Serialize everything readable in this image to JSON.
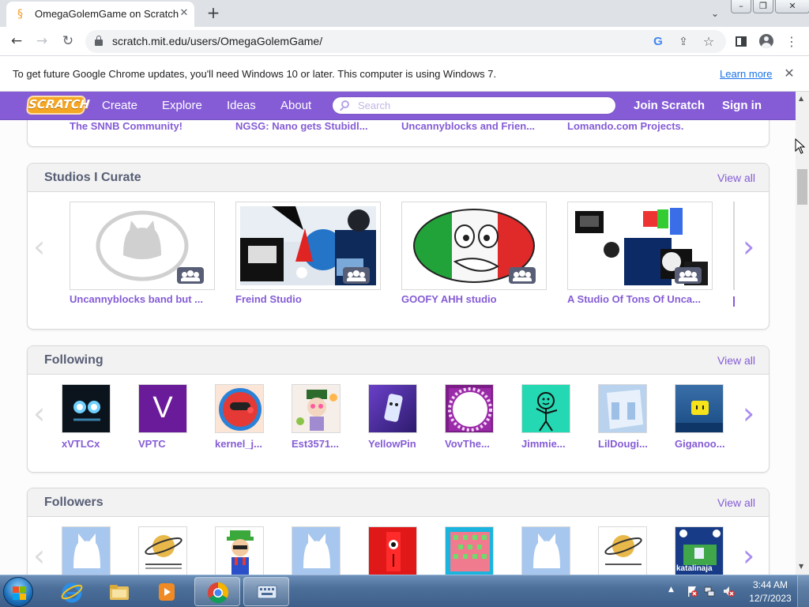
{
  "browser": {
    "tab_title": "OmegaGolemGame on Scratch",
    "url": "scratch.mit.edu/users/OmegaGolemGame/",
    "infobar_text": "To get future Google Chrome updates, you'll need Windows 10 or later. This computer is using Windows 7.",
    "infobar_link": "Learn more"
  },
  "scratch_nav": {
    "logo": "SCRATCH",
    "create": "Create",
    "explore": "Explore",
    "ideas": "Ideas",
    "about": "About",
    "search_placeholder": "Search",
    "join": "Join Scratch",
    "signin": "Sign in",
    "brand_color": "#855cd6"
  },
  "top_strip": {
    "items": [
      "The SNNB Community!",
      "NGSG: Nano gets Stubidl...",
      "Uncannyblocks and Frien...",
      "Lomando.com Projects."
    ]
  },
  "studios": {
    "title": "Studios I Curate",
    "view_all": "View all",
    "items": [
      {
        "label": "Uncannyblocks band but ..."
      },
      {
        "label": "Freind Studio"
      },
      {
        "label": "GOOFY AHH studio"
      },
      {
        "label": "A Studio Of Tons Of Unca..."
      }
    ]
  },
  "following": {
    "title": "Following",
    "view_all": "View all",
    "users": [
      "xVTLCx",
      "VPTC",
      "kernel_j...",
      "Est3571...",
      "YellowPin",
      "VovThe...",
      "Jimmie...",
      "LilDougi...",
      "Giganoo..."
    ],
    "vptc_letter": "V"
  },
  "followers": {
    "title": "Followers",
    "view_all": "View all",
    "thumb_text": "katalinaja"
  },
  "taskbar": {
    "time": "3:44 AM",
    "date": "12/7/2023"
  }
}
